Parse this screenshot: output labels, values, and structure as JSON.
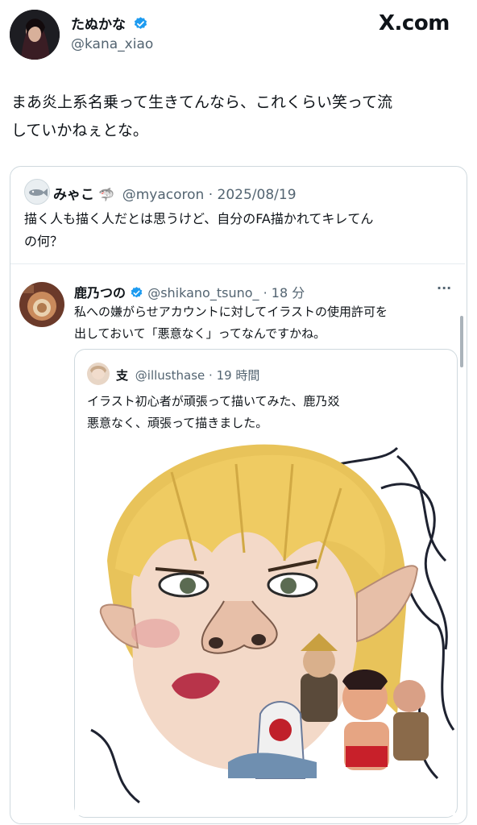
{
  "brand": "X.com",
  "main_tweet": {
    "author_name": "たぬかな",
    "handle": "@kana_xiao",
    "text_line1": "まあ炎上系名乗って生きてんなら、これくらい笑って流",
    "text_line2": "していかねぇとな。"
  },
  "quoted_tweet": {
    "author_name": "みゃこ",
    "handle": "@myacoron",
    "date": "· 2025/08/19",
    "text_line1": "描く人も描く人だとは思うけど、自分のFA描かれてキレてん",
    "text_line2": "の何？"
  },
  "reply_tweet": {
    "author_name": "鹿乃つの",
    "handle": "@shikano_tsuno_",
    "time": "· 18 分",
    "more_label": "···",
    "text_line1": "私への嫌がらせアカウントに対してイラストの使用許可を",
    "text_line2": "出しておいて「悪意なく」ってなんですかね。"
  },
  "nested_quote": {
    "author_name": "支",
    "handle": "@illusthase",
    "time": "· 19 時間",
    "text_line1": "イラスト初心者が頑張って描いてみた、鹿乃㸚",
    "text_line2": "悪意なく、頑張って描きました。"
  },
  "colors": {
    "verified": "#1d9bf0",
    "hair": "#e8c35a",
    "skin": "#f3d9c8",
    "border": "#cfd9de"
  }
}
